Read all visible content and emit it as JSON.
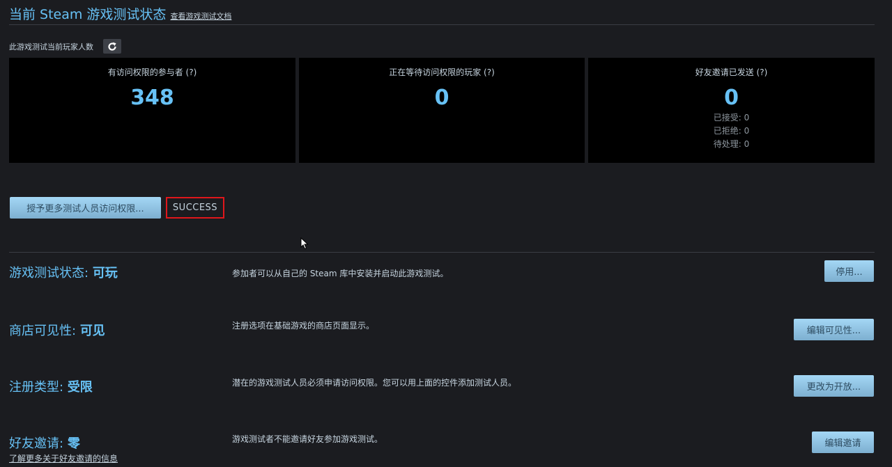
{
  "header": {
    "title": "当前 Steam 游戏测试状态",
    "doc_link": "查看游戏测试文档"
  },
  "current_players": {
    "label": "此游戏测试当前玩家人数",
    "refresh_icon": "refresh-icon"
  },
  "stats": [
    {
      "label": "有访问权限的参与者 (?)",
      "value": "348"
    },
    {
      "label": "正在等待访问权限的玩家 (?)",
      "value": "0"
    },
    {
      "label": "好友邀请已发送 (?)",
      "value": "0",
      "accepted": "已接受: 0",
      "declined": "已拒绝: 0",
      "pending": "待处理: 0"
    }
  ],
  "grant": {
    "button_label": "授予更多测试人员访问权限...",
    "status": "SUCCESS",
    "status_border_color": "#e0161b"
  },
  "settings": {
    "playtest_state": {
      "title": "游戏测试状态:",
      "value": "可玩",
      "desc": "参加者可以从自己的 Steam 库中安装并启动此游戏测试。",
      "button": "停用..."
    },
    "store_visibility": {
      "title": "商店可见性:",
      "value": "可见",
      "desc": "注册选项在基础游戏的商店页面显示。",
      "button": "编辑可见性..."
    },
    "signup_type": {
      "title": "注册类型:",
      "value": "受限",
      "desc": "潜在的游戏测试人员必须申请访问权限。您可以用上面的控件添加测试人员。",
      "button": "更改为开放..."
    },
    "friend_invites": {
      "title": "好友邀请:",
      "value": "零",
      "desc": "游戏测试者不能邀请好友参加游戏测试。",
      "button": "编辑邀请",
      "link": "了解更多关于好友邀请的信息"
    }
  },
  "colors": {
    "accent": "#67c1f5",
    "background": "#1b1c20",
    "panel": "#000000",
    "button_gradient_top": "#a4d7f5",
    "button_gradient_bottom": "#7dafd0"
  }
}
